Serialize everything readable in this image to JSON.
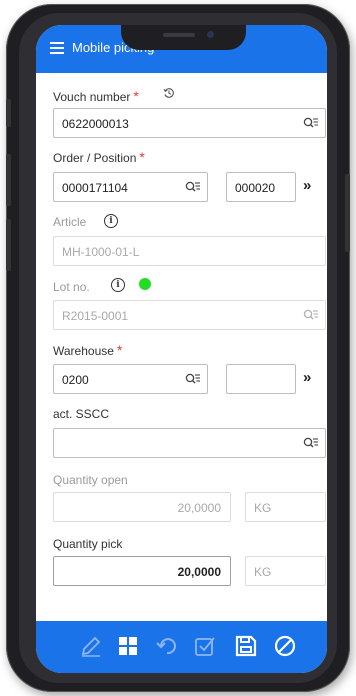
{
  "app": {
    "title": "Mobile picking"
  },
  "form": {
    "voucher": {
      "label": "Vouch number",
      "value": "0622000013"
    },
    "order": {
      "label": "Order / Position",
      "order_value": "0000171104",
      "position_value": "000020",
      "next": "»"
    },
    "article": {
      "label": "Article",
      "value": "MH-1000-01-L"
    },
    "lot": {
      "label": "Lot no.",
      "value": "R2015-0001",
      "status_color": "#22dd22"
    },
    "warehouse": {
      "label": "Warehouse",
      "value": "0200",
      "sub_value": "",
      "next": "»"
    },
    "sscc": {
      "label": "act. SSCC",
      "value": ""
    },
    "qty_open": {
      "label": "Quantity open",
      "value": "20,0000",
      "unit": "KG"
    },
    "qty_pick": {
      "label": "Quantity pick",
      "value": "20,0000",
      "unit": "KG"
    },
    "required_mark": "*"
  },
  "bottom_bar": {
    "icons": [
      "pencil-icon",
      "grid-icon",
      "undo-icon",
      "check-box-icon",
      "save-icon",
      "cancel-icon"
    ]
  },
  "colors": {
    "accent": "#1a73e8",
    "required": "#e53935"
  }
}
